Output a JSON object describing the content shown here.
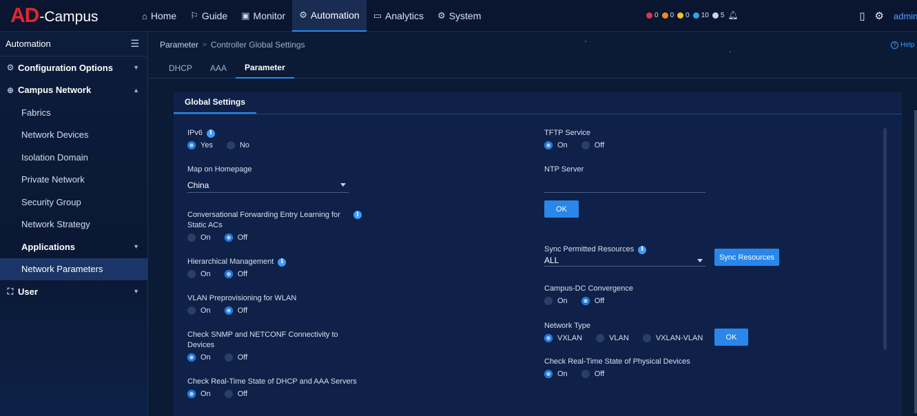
{
  "app": {
    "logo_mark": "AD",
    "logo_text": "-Campus"
  },
  "topnav": [
    {
      "icon": "home-icon",
      "label": "Home"
    },
    {
      "icon": "guide-icon",
      "label": "Guide"
    },
    {
      "icon": "monitor-icon",
      "label": "Monitor"
    },
    {
      "icon": "automation-icon",
      "label": "Automation"
    },
    {
      "icon": "analytics-icon",
      "label": "Analytics"
    },
    {
      "icon": "system-icon",
      "label": "System"
    }
  ],
  "alarms": [
    {
      "color": "#e0344a",
      "count": "0"
    },
    {
      "color": "#f08a1c",
      "count": "0"
    },
    {
      "color": "#f3c41c",
      "count": "0"
    },
    {
      "color": "#2aa7e8",
      "count": "10"
    },
    {
      "color": "#c9d3e4",
      "count": "5"
    }
  ],
  "user": {
    "name": "admin"
  },
  "sidebar": {
    "title": "Automation",
    "items": [
      {
        "label": "Configuration Options"
      },
      {
        "label": "Campus Network"
      },
      {
        "label": "Fabrics"
      },
      {
        "label": "Network Devices"
      },
      {
        "label": "Isolation Domain"
      },
      {
        "label": "Private Network"
      },
      {
        "label": "Security Group"
      },
      {
        "label": "Network Strategy"
      },
      {
        "label": "Applications"
      },
      {
        "label": "Network Parameters"
      },
      {
        "label": "User"
      }
    ]
  },
  "breadcrumb": {
    "root": "Parameter",
    "sep": ">",
    "current": "Controller Global Settings"
  },
  "help": {
    "label": "Help"
  },
  "tabs": [
    {
      "label": "DHCP"
    },
    {
      "label": "AAA"
    },
    {
      "label": "Parameter"
    }
  ],
  "panel": {
    "tab": "Global Settings"
  },
  "left": {
    "ipv6": {
      "label": "IPv6",
      "yes": "Yes",
      "no": "No"
    },
    "map": {
      "label": "Map on Homepage",
      "value": "China"
    },
    "conv": {
      "label1": "Conversational Forwarding Entry Learning for",
      "label2": "Static ACs",
      "on": "On",
      "off": "Off"
    },
    "hier": {
      "label": "Hierarchical Management",
      "on": "On",
      "off": "Off"
    },
    "vlan": {
      "label": "VLAN Preprovisioning for WLAN",
      "on": "On",
      "off": "Off"
    },
    "snmp": {
      "label1": "Check SNMP and NETCONF Connectivity to",
      "label2": "Devices",
      "on": "On",
      "off": "Off"
    },
    "dhcp": {
      "label": "Check Real-Time State of DHCP and AAA Servers",
      "on": "On",
      "off": "Off"
    }
  },
  "right": {
    "tftp": {
      "label": "TFTP Service",
      "on": "On",
      "off": "Off"
    },
    "ntp": {
      "label": "NTP Server",
      "value": ""
    },
    "ok1": "OK",
    "sync": {
      "label": "Sync Permitted Resources",
      "value": "ALL",
      "button": "Sync Resources"
    },
    "campusdc": {
      "label": "Campus-DC Convergence",
      "on": "On",
      "off": "Off"
    },
    "nettype": {
      "label": "Network Type",
      "opt1": "VXLAN",
      "opt2": "VLAN",
      "opt3": "VXLAN-VLAN",
      "button": "OK"
    },
    "phys": {
      "label": "Check Real-Time State of Physical Devices",
      "on": "On",
      "off": "Off"
    }
  }
}
